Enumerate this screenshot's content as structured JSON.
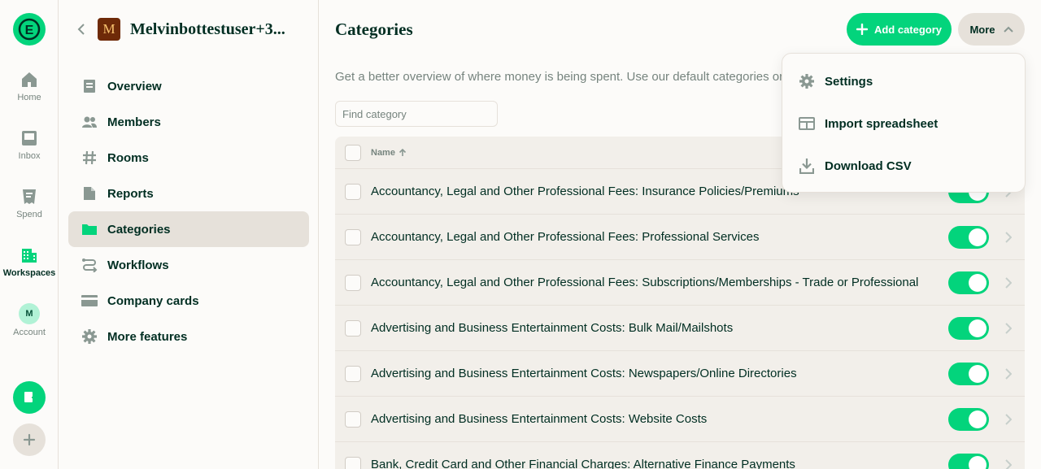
{
  "rail": {
    "logo_letter": "E",
    "items": [
      {
        "label": "Home",
        "icon": "home-icon"
      },
      {
        "label": "Inbox",
        "icon": "inbox-icon"
      },
      {
        "label": "Spend",
        "icon": "receipt-icon"
      },
      {
        "label": "Workspaces",
        "icon": "building-icon",
        "active": true
      },
      {
        "label": "Account",
        "icon": "avatar",
        "avatar_letter": "M"
      }
    ]
  },
  "workspace": {
    "badge_letter": "M",
    "name": "Melvinbottestuser+3...",
    "menu": [
      {
        "label": "Overview",
        "icon": "document-icon"
      },
      {
        "label": "Members",
        "icon": "users-icon"
      },
      {
        "label": "Rooms",
        "icon": "hashtag-icon"
      },
      {
        "label": "Reports",
        "icon": "file-icon"
      },
      {
        "label": "Categories",
        "icon": "folder-icon",
        "active": true
      },
      {
        "label": "Workflows",
        "icon": "workflow-icon"
      },
      {
        "label": "Company cards",
        "icon": "card-icon"
      },
      {
        "label": "More features",
        "icon": "gear-icon"
      }
    ]
  },
  "main": {
    "title": "Categories",
    "add_label": "Add category",
    "more_label": "More",
    "description": "Get a better overview of where money is being spent. Use our default categories or",
    "search_placeholder": "Find category",
    "column_name": "Name",
    "rows": [
      "Accountancy, Legal and Other Professional Fees: Insurance Policies/Premiums",
      "Accountancy, Legal and Other Professional Fees: Professional Services",
      "Accountancy, Legal and Other Professional Fees: Subscriptions/Memberships - Trade or Professional",
      "Advertising and Business Entertainment Costs: Bulk Mail/Mailshots",
      "Advertising and Business Entertainment Costs: Newspapers/Online Directories",
      "Advertising and Business Entertainment Costs: Website Costs",
      "Bank, Credit Card and Other Financial Charges: Alternative Finance Payments"
    ]
  },
  "more_menu": [
    {
      "label": "Settings",
      "icon": "gear-icon"
    },
    {
      "label": "Import spreadsheet",
      "icon": "table-icon"
    },
    {
      "label": "Download CSV",
      "icon": "download-icon"
    }
  ],
  "colors": {
    "accent": "#03d47c",
    "text": "#002e22",
    "muted": "#76847e"
  }
}
